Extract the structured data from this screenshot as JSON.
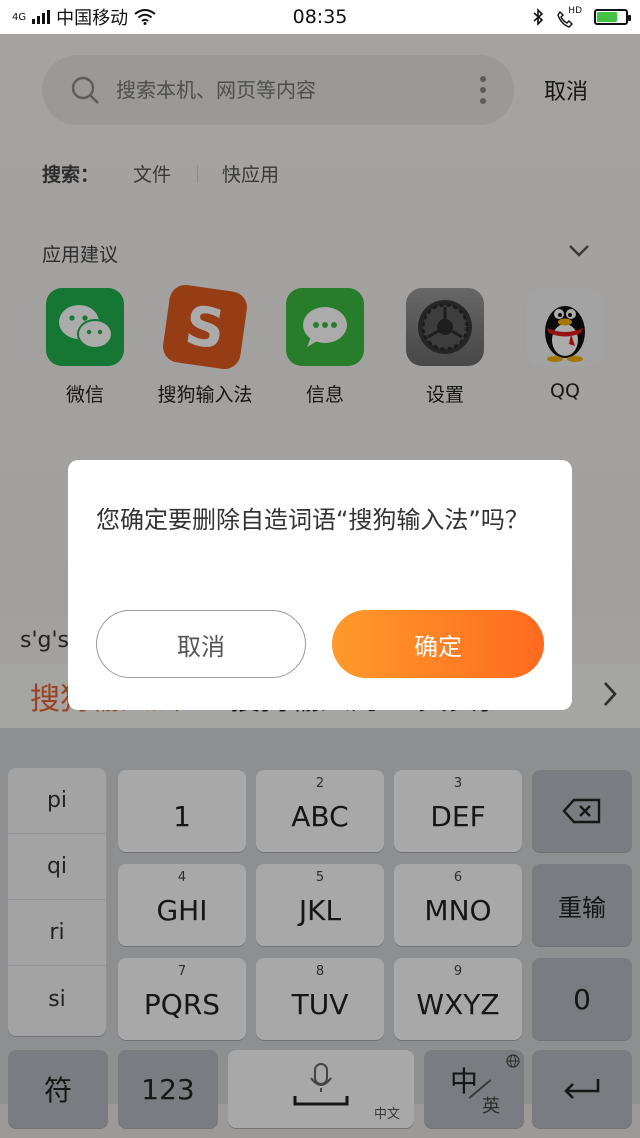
{
  "status_bar": {
    "network": "4G",
    "carrier": "中国移动",
    "time": "08:35",
    "hd_label": "HD"
  },
  "search": {
    "placeholder": "搜索本机、网页等内容",
    "cancel_label": "取消",
    "scope_label": "搜索：",
    "scope_items": [
      "文件",
      "快应用"
    ]
  },
  "suggestions": {
    "title": "应用建议",
    "apps": [
      {
        "label": "微信",
        "icon": "wechat-icon",
        "color": "#22b14c"
      },
      {
        "label": "搜狗输入法",
        "icon": "sogou-icon",
        "color": "#e25c22"
      },
      {
        "label": "信息",
        "icon": "messages-icon",
        "color": "#3dbb3f"
      },
      {
        "label": "设置",
        "icon": "settings-gear-icon",
        "color": "#7a7a7a"
      },
      {
        "label": "QQ",
        "icon": "qq-penguin-icon",
        "color": "#111111"
      }
    ]
  },
  "ime": {
    "composing": "s'g's",
    "candidates": [
      "搜狗输入法",
      "搜狗输入的",
      "其实我"
    ],
    "pinyin": [
      "pi",
      "qi",
      "ri",
      "si"
    ],
    "keys": {
      "k1": "1",
      "k2_num": "2",
      "k2": "ABC",
      "k3_num": "3",
      "k3": "DEF",
      "k4_num": "4",
      "k4": "GHI",
      "k5_num": "5",
      "k5": "JKL",
      "k6_num": "6",
      "k6": "MNO",
      "k7_num": "7",
      "k7": "PQRS",
      "k8_num": "8",
      "k8": "TUV",
      "k9_num": "9",
      "k9": "WXYZ",
      "reinput": "重输",
      "zero": "0",
      "symbol": "符",
      "num123": "123",
      "space_hint": "中文",
      "lang_zh": "中",
      "lang_en": "英"
    }
  },
  "dialog": {
    "message": "您确定要删除自造词语“搜狗输入法”吗？",
    "cancel_label": "取消",
    "confirm_label": "确定",
    "confirm_color": "#ff7a22"
  }
}
